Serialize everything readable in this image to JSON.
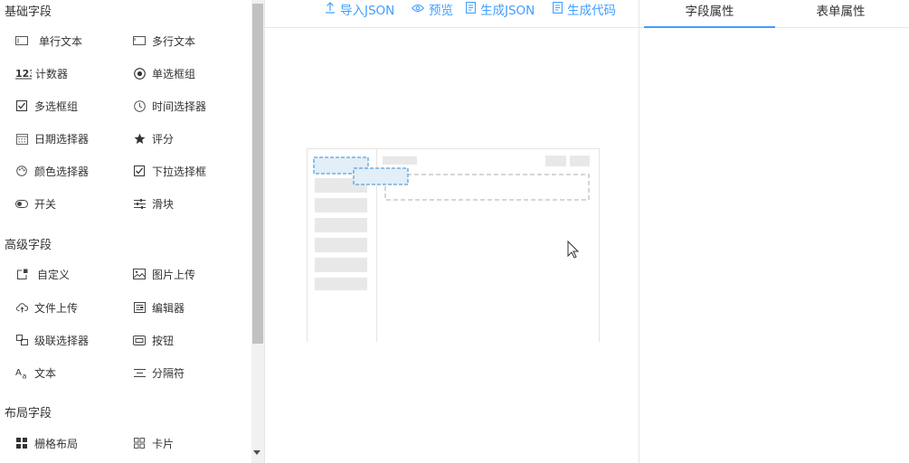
{
  "palette": {
    "groups": [
      {
        "title": "基础字段",
        "items": [
          {
            "label": "单行文本",
            "icon": "input-icon"
          },
          {
            "label": "多行文本",
            "icon": "textarea-icon"
          },
          {
            "label": "计数器",
            "icon": "number-icon"
          },
          {
            "label": "单选框组",
            "icon": "radio-icon"
          },
          {
            "label": "多选框组",
            "icon": "checkbox-icon"
          },
          {
            "label": "时间选择器",
            "icon": "clock-icon"
          },
          {
            "label": "日期选择器",
            "icon": "calendar-icon"
          },
          {
            "label": "评分",
            "icon": "star-icon"
          },
          {
            "label": "颜色选择器",
            "icon": "palette-icon"
          },
          {
            "label": "下拉选择框",
            "icon": "select-icon"
          },
          {
            "label": "开关",
            "icon": "switch-icon"
          },
          {
            "label": "滑块",
            "icon": "slider-icon"
          }
        ]
      },
      {
        "title": "高级字段",
        "items": [
          {
            "label": "自定义",
            "icon": "custom-icon"
          },
          {
            "label": "图片上传",
            "icon": "image-icon"
          },
          {
            "label": "文件上传",
            "icon": "upload-icon"
          },
          {
            "label": "编辑器",
            "icon": "editor-icon"
          },
          {
            "label": "级联选择器",
            "icon": "cascader-icon"
          },
          {
            "label": "按钮",
            "icon": "button-icon"
          },
          {
            "label": "文本",
            "icon": "text-icon"
          },
          {
            "label": "分隔符",
            "icon": "divider-icon"
          }
        ]
      },
      {
        "title": "布局字段",
        "items": [
          {
            "label": "栅格布局",
            "icon": "grid-icon"
          },
          {
            "label": "卡片",
            "icon": "card-icon"
          }
        ]
      }
    ]
  },
  "toolbar": {
    "import_json": "导入JSON",
    "preview": "预览",
    "generate_json": "生成JSON",
    "generate_code": "生成代码"
  },
  "tabs": {
    "field_props": "字段属性",
    "form_props": "表单属性",
    "active": "field_props"
  },
  "colors": {
    "accent": "#409eff",
    "text": "#333333",
    "border": "#e6e6e6",
    "placeholder_block": "#e8e8e8",
    "drag_dashed": "#5aa0d8"
  }
}
